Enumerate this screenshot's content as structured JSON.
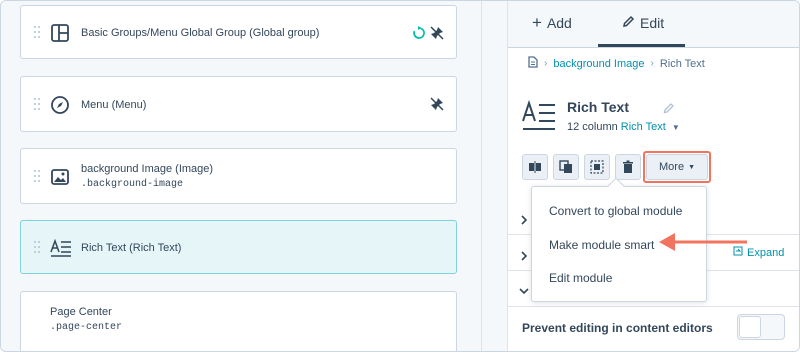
{
  "left_panel": {
    "modules": [
      {
        "title": "Basic Groups/Menu Global Group (Global group)",
        "class_name": "",
        "icon": "layout-icon",
        "right_icons": [
          "sync-icon",
          "unpin-icon"
        ]
      },
      {
        "title": "Menu (Menu)",
        "class_name": "",
        "icon": "compass-icon",
        "right_icons": [
          "unpin-icon"
        ]
      },
      {
        "title": "background Image (Image)",
        "class_name": ".background-image",
        "icon": "image-icon",
        "right_icons": []
      },
      {
        "title": "Rich Text (Rich Text)",
        "class_name": "",
        "icon": "rich-text-icon",
        "right_icons": [],
        "selected": true
      },
      {
        "title": "Page Center",
        "class_name": ".page-center",
        "icon": "",
        "right_icons": []
      }
    ]
  },
  "right_panel": {
    "tabs": [
      {
        "label": "Add",
        "icon": "plus-icon"
      },
      {
        "label": "Edit",
        "icon": "pencil-icon",
        "active": true
      }
    ],
    "breadcrumb": {
      "icon": "document-icon",
      "items": [
        "background Image",
        "Rich Text"
      ]
    },
    "module": {
      "name": "Rich Text",
      "columns_text": "12 column",
      "type_link": "Rich Text"
    },
    "toolbar": {
      "buttons": [
        "split-icon",
        "duplicate-icon",
        "select-icon",
        "trash-icon"
      ],
      "more_label": "More"
    },
    "expand_label": "Expand",
    "prevent_label": "Prevent editing in content editors"
  },
  "dropdown": {
    "items": [
      "Convert to global module",
      "Make module smart",
      "Edit module"
    ]
  },
  "colors": {
    "accent_teal": "#0091ae",
    "highlight_orange": "#f2745f",
    "text_dark": "#33475b",
    "selected_bg": "#e5f5f8",
    "selected_border": "#7fd1de"
  }
}
